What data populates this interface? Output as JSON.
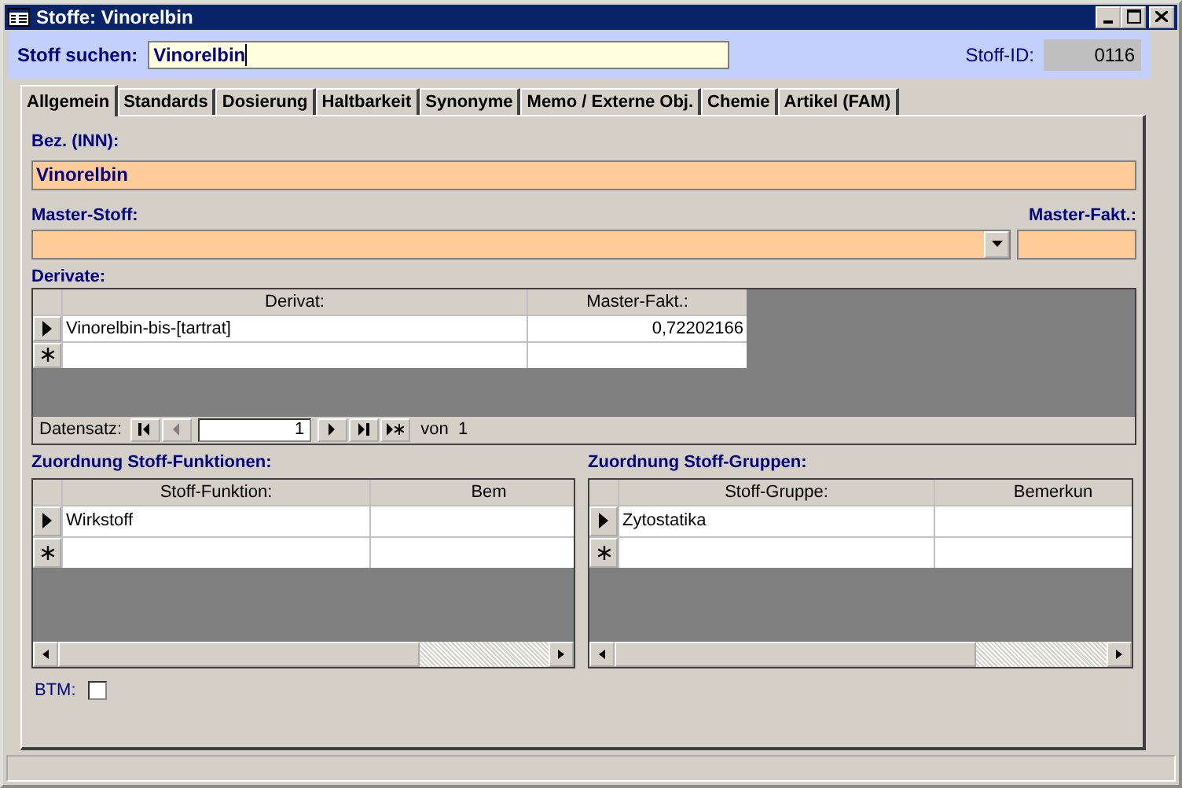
{
  "window": {
    "title": "Stoffe: Vinorelbin"
  },
  "search": {
    "label": "Stoff suchen:",
    "value": "Vinorelbin",
    "id_label": "Stoff-ID:",
    "id_value": "0116"
  },
  "tabs": [
    {
      "label": "Allgemein",
      "selected": true
    },
    {
      "label": "Standards",
      "selected": false
    },
    {
      "label": "Dosierung",
      "selected": false
    },
    {
      "label": "Haltbarkeit",
      "selected": false
    },
    {
      "label": "Synonyme",
      "selected": false
    },
    {
      "label": "Memo / Externe Obj.",
      "selected": false
    },
    {
      "label": "Chemie",
      "selected": false
    },
    {
      "label": "Artikel (FAM)",
      "selected": false
    }
  ],
  "bezeichnung": {
    "label": "Bez. (INN):",
    "value": "Vinorelbin"
  },
  "master_stoff": {
    "label": "Master-Stoff:"
  },
  "master_fakt": {
    "label": "Master-Fakt.:"
  },
  "derivate": {
    "label": "Derivate:",
    "columns": [
      "Derivat:",
      "Master-Fakt.:"
    ],
    "rows": [
      {
        "cells": [
          "Vinorelbin-bis-[tartrat]",
          "0,72202166"
        ],
        "current": true
      }
    ],
    "navigator": {
      "label": "Datensatz:",
      "record": "1",
      "total": "von  1"
    }
  },
  "funktionen": {
    "label": "Zuordnung Stoff-Funktionen:",
    "columns": [
      "Stoff-Funktion:",
      "Bem"
    ],
    "rows": [
      {
        "cells": [
          "Wirkstoff"
        ],
        "current": true
      }
    ]
  },
  "gruppen": {
    "label": "Zuordnung Stoff-Gruppen:",
    "columns": [
      "Stoff-Gruppe:",
      "Bemerkun"
    ],
    "rows": [
      {
        "cells": [
          "Zytostatika"
        ],
        "current": true
      }
    ]
  },
  "btm": {
    "label": "BTM:",
    "checked": false
  }
}
